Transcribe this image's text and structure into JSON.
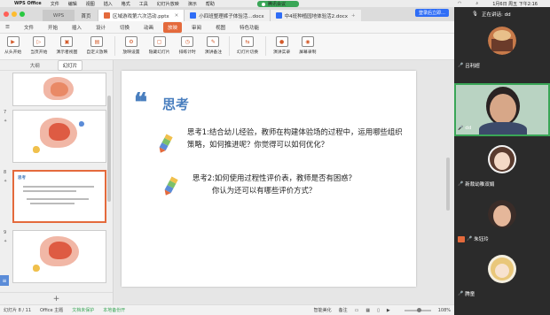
{
  "macbar": {
    "app": "WPS Office",
    "menus": [
      "文件",
      "编辑",
      "视图",
      "插入",
      "格式",
      "工具",
      "幻灯片放映",
      "演示",
      "帮助"
    ],
    "meeting_label": "腾讯会议",
    "time": "1月6日 周五 下午2:16"
  },
  "tabs": {
    "wps_label": "WPS",
    "home_label": "首页",
    "docs": [
      {
        "label": "区域游戏第六次活动.pptx",
        "color": "#e46a3c"
      },
      {
        "label": "小四班整理裤子体验活...docx",
        "color": "#2f6df6"
      },
      {
        "label": "中4班种植园地体验活2.docx",
        "color": "#2f6df6"
      }
    ],
    "login": "登录后立即…"
  },
  "menu": {
    "file": "文件",
    "items": [
      "开始",
      "插入",
      "设计",
      "切换",
      "动画",
      "放映",
      "审阅",
      "视图",
      "特色功能"
    ],
    "selected": "放映"
  },
  "toolbar": {
    "tools": [
      {
        "label": "从头开始",
        "icon": "play-icon"
      },
      {
        "label": "当页开始",
        "icon": "play-current-icon"
      },
      {
        "label": "演示者视图",
        "icon": "presenter-icon"
      },
      {
        "label": "自定义放映",
        "icon": "custom-show-icon"
      },
      {
        "label": "放映设置",
        "icon": "settings-icon"
      },
      {
        "label": "隐藏幻灯片",
        "icon": "hide-slide-icon"
      },
      {
        "label": "排练计时",
        "icon": "timer-icon"
      },
      {
        "label": "演讲备注",
        "icon": "notes-icon"
      },
      {
        "label": "幻灯片切换",
        "icon": "transition-icon"
      },
      {
        "label": "演讲实录",
        "icon": "record-icon"
      },
      {
        "label": "屏幕录制",
        "icon": "screen-record-icon"
      }
    ]
  },
  "leftpanel": {
    "tab_outline": "大纲",
    "tab_slides": "幻灯片",
    "thumbs": [
      {
        "num": "7",
        "title": ""
      },
      {
        "num": "8",
        "title": "思考"
      },
      {
        "num": "9",
        "title": ""
      }
    ]
  },
  "slide": {
    "quote_mark": "❝",
    "title": "思考",
    "q1_line1": "思考1:结合幼儿经验，教师在构建体验场的过程中，运用哪些组织",
    "q1_line2": "策略，如何推进呢？你觉得可以如何优化？",
    "q2_line1": "思考2:如何使用过程性评价表，教师是否有困惑？",
    "q2_line2": "你认为还可以有哪些评价方式？"
  },
  "statusbar": {
    "page": "幻灯片 8 / 11",
    "theme": "Office 主题",
    "protect": "文档未保护",
    "backup": "本地备份开",
    "smart": "智能美化",
    "notes": "备注",
    "zoom": "108%"
  },
  "participants": {
    "speaking": "正在讲话: dd",
    "people": [
      {
        "name": "吕利超",
        "type": "avatar"
      },
      {
        "name": "dd",
        "type": "video"
      },
      {
        "name": "新裁幼稚双娟",
        "type": "avatar"
      },
      {
        "name": "朱钰玲",
        "type": "avatar",
        "host": true
      },
      {
        "name": "腾童",
        "type": "avatar"
      }
    ]
  }
}
